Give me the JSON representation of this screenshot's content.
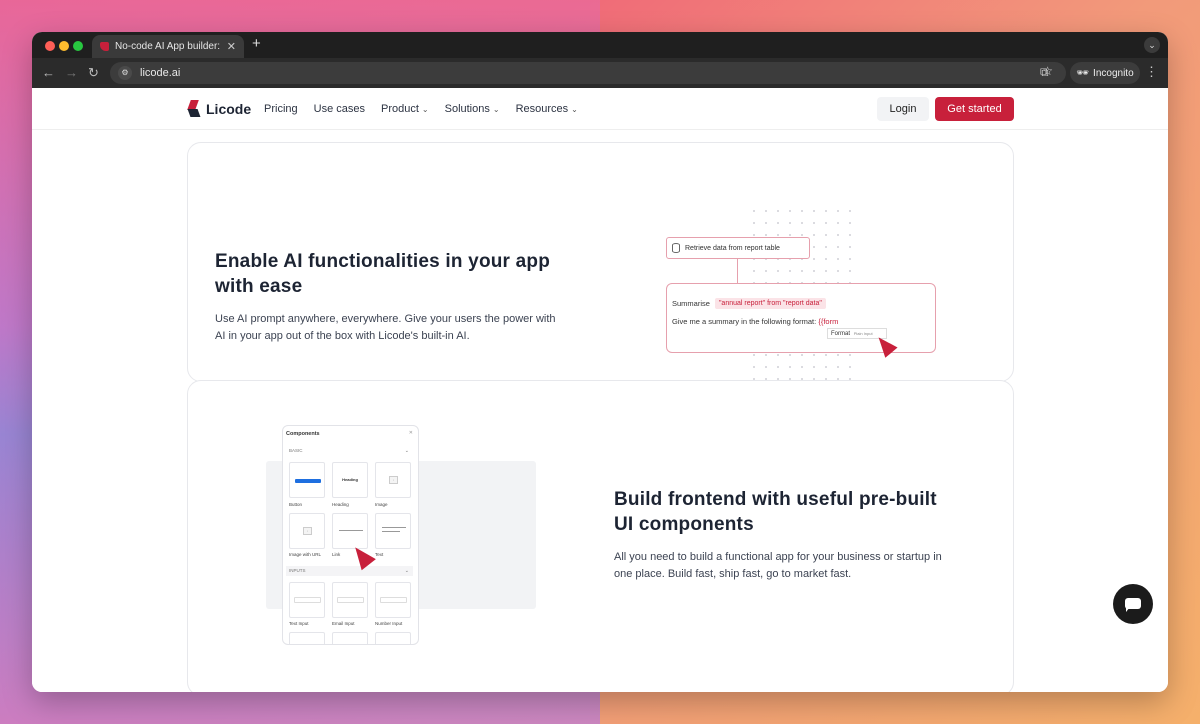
{
  "browser": {
    "tab_title": "No-code AI App builder: Build",
    "url": "licode.ai",
    "incognito_label": "Incognito"
  },
  "nav": {
    "logo": "Licode",
    "items": [
      "Pricing",
      "Use cases",
      "Product",
      "Solutions",
      "Resources"
    ],
    "login": "Login",
    "get_started": "Get started"
  },
  "section1": {
    "title_line1": "Enable AI functionalities in your app",
    "title_line2": "with ease",
    "desc_line1": "Use AI prompt anywhere, everywhere. Give your users the power with",
    "desc_line2": "AI in your app out of the box with Licode's built-in AI.",
    "flow": {
      "step1": "Retrieve data from report table",
      "summarise": "Summarise",
      "summarise_pill": "\"annual report\" from \"report data\"",
      "summary_text": "Give me a summary in the following format:",
      "summary_var": "{{form",
      "format_label": "Format",
      "format_hint": "Plain Input"
    }
  },
  "section2": {
    "title_line1": "Build frontend with useful pre-built",
    "title_line2": "UI components",
    "desc_line1": "All you need to build a functional app for your business or startup in",
    "desc_line2": "one place. Build fast, ship fast, go to market fast.",
    "panel": {
      "title": "Components",
      "basic": "BASIC",
      "inputs": "INPUTS",
      "tiles": [
        "Button",
        "Heading",
        "Image",
        "Image with URL",
        "Link",
        "Text",
        "Text Input",
        "Email Input",
        "Number Input"
      ],
      "heading_preview": "Heading"
    }
  },
  "colors": {
    "accent": "#c8203b",
    "dark": "#1d2433"
  }
}
